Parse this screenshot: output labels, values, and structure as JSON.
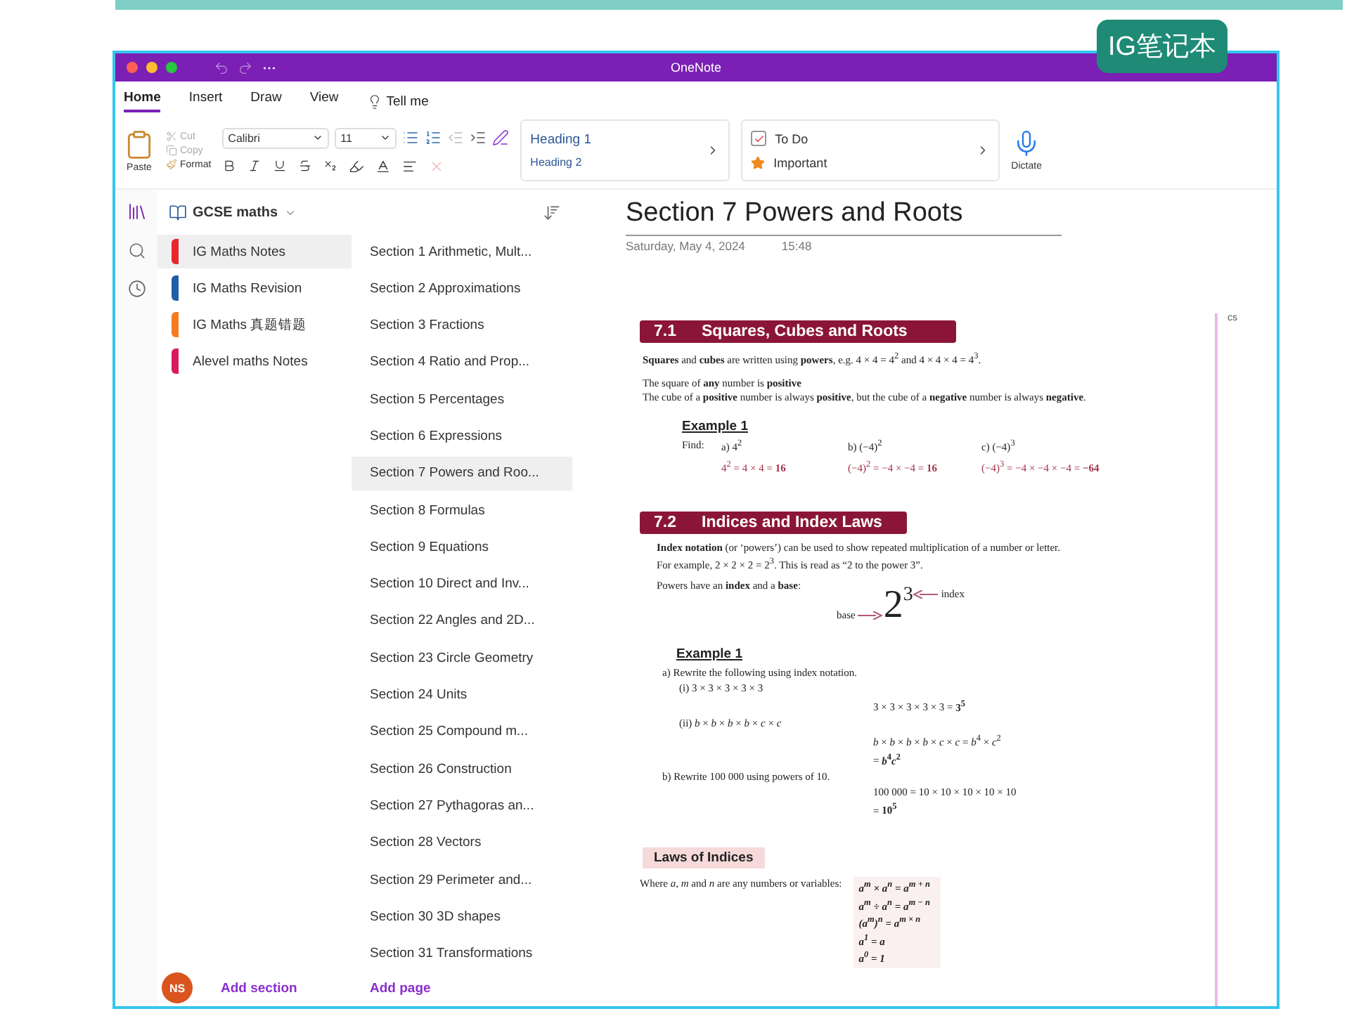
{
  "badge": "IG笔记本",
  "window": {
    "title": "OneNote"
  },
  "menu_tabs": [
    {
      "label": "Home",
      "selected": true
    },
    {
      "label": "Insert",
      "selected": false
    },
    {
      "label": "Draw",
      "selected": false
    },
    {
      "label": "View",
      "selected": false
    }
  ],
  "tell_me": "Tell me",
  "ribbon": {
    "paste": "Paste",
    "cut": "Cut",
    "copy": "Copy",
    "format": "Format",
    "font": "Calibri",
    "size": "11",
    "styles": [
      "Heading 1",
      "Heading 2"
    ],
    "tags": [
      {
        "kind": "checkbox",
        "label": "To Do",
        "checked": true
      },
      {
        "kind": "star",
        "label": "Important"
      }
    ],
    "dictate": "Dictate"
  },
  "notebook": "GCSE maths",
  "sections": [
    {
      "name": "IG Maths Notes",
      "color": "#e8262b",
      "selected": true
    },
    {
      "name": "IG Maths Revision",
      "color": "#1f5fa8",
      "selected": false
    },
    {
      "name": "IG Maths 真题错题",
      "color": "#f47b20",
      "selected": false
    },
    {
      "name": "Alevel maths Notes",
      "color": "#d81b60",
      "selected": false
    }
  ],
  "pages": [
    {
      "title": "Section 1 Arithmetic, Mult...",
      "selected": false
    },
    {
      "title": "Section 2 Approximations",
      "selected": false
    },
    {
      "title": "Section 3 Fractions",
      "selected": false
    },
    {
      "title": "Section 4 Ratio and Prop...",
      "selected": false
    },
    {
      "title": "Section 5 Percentages",
      "selected": false
    },
    {
      "title": "Section 6 Expressions",
      "selected": false
    },
    {
      "title": "Section 7 Powers and Roo...",
      "selected": true
    },
    {
      "title": "Section 8 Formulas",
      "selected": false
    },
    {
      "title": "Section 9 Equations",
      "selected": false
    },
    {
      "title": "Section 10 Direct and Inv...",
      "selected": false
    },
    {
      "title": "Section 22 Angles and 2D...",
      "selected": false
    },
    {
      "title": "Section 23 Circle Geometry",
      "selected": false
    },
    {
      "title": "Section 24 Units",
      "selected": false
    },
    {
      "title": "Section 25 Compound m...",
      "selected": false
    },
    {
      "title": "Section 26 Construction",
      "selected": false
    },
    {
      "title": "Section 27 Pythagoras an...",
      "selected": false
    },
    {
      "title": "Section 28 Vectors",
      "selected": false
    },
    {
      "title": "Section 29 Perimeter and...",
      "selected": false
    },
    {
      "title": "Section 30 3D shapes",
      "selected": false
    },
    {
      "title": "Section 31 Transformations",
      "selected": false
    }
  ],
  "footer": {
    "avatar": "NS",
    "add_section": "Add section",
    "add_page": "Add page"
  },
  "page": {
    "title": "Section 7 Powers and Roots",
    "date": "Saturday, May 4, 2024",
    "time": "15:48",
    "margin_note": "cs",
    "section_1": {
      "number": "7.1",
      "title": "Squares, Cubes and Roots",
      "paragraphs": [
        "**Squares** and **cubes** are written using **powers**, e.g. 4 × 4 = 4$^{2}$ and 4 × 4 × 4 = 4$^{3}$.",
        "The square of **any** number is **positive**",
        "The cube of a **positive** number is always **positive**, but the cube of a **negative** number is always **negative**."
      ],
      "example": {
        "title": "Example 1",
        "prompt": "Find:",
        "parts": [
          {
            "label": "a)",
            "question": "4$^{2}$",
            "answer": "4$^{2}$ = 4 × 4 = **16**"
          },
          {
            "label": "b)",
            "question": "(−4)$^{2}$",
            "answer": "(−4)$^{2}$ = −4 × −4 = **16**"
          },
          {
            "label": "c)",
            "question": "(−4)$^{3}$",
            "answer": "(−4)$^{3}$ = −4 × −4 × −4 = **−64**"
          }
        ]
      }
    },
    "section_2": {
      "number": "7.2",
      "title": "Indices and Index Laws",
      "paragraphs": [
        "**Index notation** (or ‘powers’) can be used to show repeated multiplication of a number or letter.",
        "For example, 2 × 2 × 2 = 2$^{3}$.  This is read as “2 to the power 3”."
      ],
      "powers_line": "Powers have an **index** and a **base**:",
      "diagram": {
        "base_label": "base",
        "base": "2",
        "index": "3",
        "index_label": "index"
      },
      "example": {
        "title": "Example 1",
        "items": [
          {
            "kind": "question",
            "text": "a)  Rewrite the following using index notation."
          },
          {
            "kind": "sub",
            "text": "(i) 3 × 3 × 3 × 3 × 3"
          },
          {
            "kind": "answer",
            "text": "3 × 3 × 3 × 3 × 3 = **3$^{5}$**"
          },
          {
            "kind": "sub",
            "text": "(ii) *b* × *b* × *b* × *b* × *c* × *c*"
          },
          {
            "kind": "answer",
            "text": "*b* × *b* × *b* × *b* × *c* × *c* = *b*$^{4}$ × *c*$^{2}$"
          },
          {
            "kind": "answer",
            "text": "= ***b*$^{4}$*c*$^{2}$**"
          },
          {
            "kind": "question",
            "text": "b)  Rewrite 100 000 using powers of 10."
          },
          {
            "kind": "answer",
            "text": "100 000 = 10 × 10 × 10 × 10 × 10"
          },
          {
            "kind": "answer",
            "text": "= **10$^{5}$**"
          }
        ]
      },
      "laws": {
        "title": "Laws of Indices",
        "intro": "Where *a*, *m* and *n* are any numbers or variables:",
        "items": [
          "a$^{m}$ × a$^{n}$ = a$^{m + n}$",
          "a$^{m}$ ÷ a$^{n}$ = a$^{m − n}$",
          "(a$^{m}$)$^{n}$ = a$^{m × n}$",
          "a$^{1}$ = a",
          "a$^{0}$ = 1"
        ]
      }
    }
  }
}
